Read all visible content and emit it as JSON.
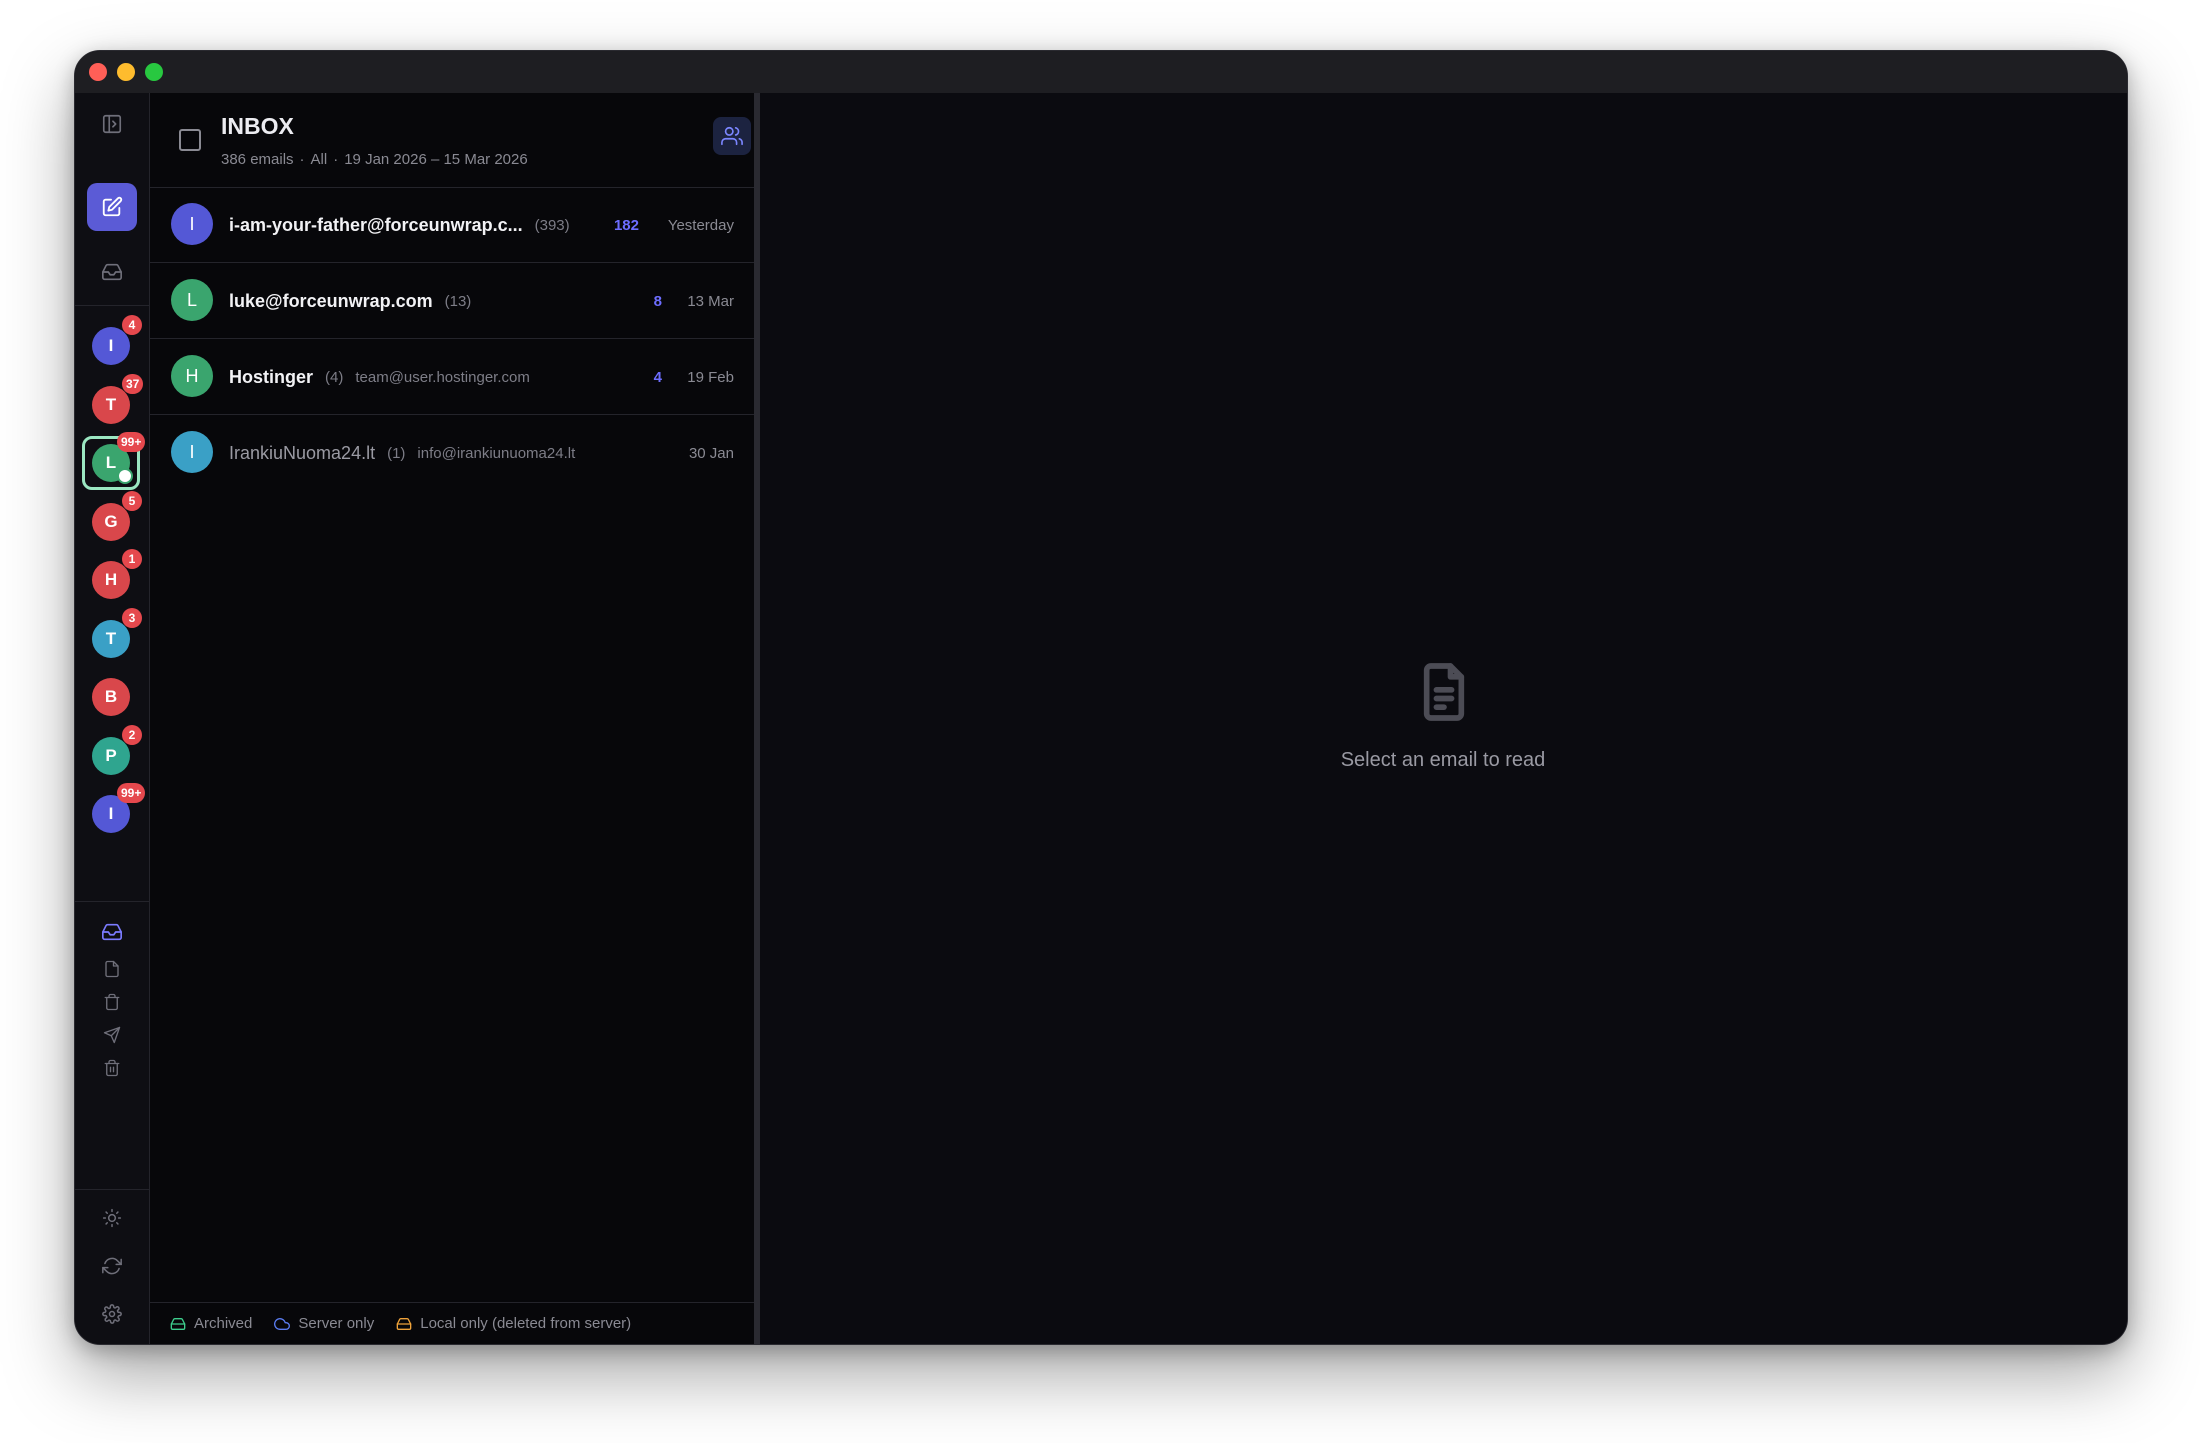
{
  "header": {
    "title": "INBOX",
    "email_count": "386 emails",
    "filter": "All",
    "date_range": "19 Jan 2026 – 15 Mar 2026"
  },
  "accounts": [
    {
      "initial": "I",
      "color": "#5458d6",
      "badge": "4"
    },
    {
      "initial": "T",
      "color": "#d9474b",
      "badge": "37"
    },
    {
      "initial": "L",
      "color": "#3aa56e",
      "badge": "99+",
      "selected": true
    },
    {
      "initial": "G",
      "color": "#d9474b",
      "badge": "5"
    },
    {
      "initial": "H",
      "color": "#d9474b",
      "badge": "1"
    },
    {
      "initial": "T",
      "color": "#3aa0c6",
      "badge": "3"
    },
    {
      "initial": "B",
      "color": "#d9474b",
      "badge": ""
    },
    {
      "initial": "P",
      "color": "#2fa58f",
      "badge": "2"
    },
    {
      "initial": "I",
      "color": "#5458d6",
      "badge": "99+"
    }
  ],
  "emails": [
    {
      "initial": "I",
      "color": "#5458d6",
      "sender": "i-am-your-father@forceunwrap.c...",
      "count": "(393)",
      "email": "",
      "unread": "182",
      "date": "Yesterday"
    },
    {
      "initial": "L",
      "color": "#3aa56e",
      "sender": "luke@forceunwrap.com",
      "count": "(13)",
      "email": "",
      "unread": "8",
      "date": "13 Mar"
    },
    {
      "initial": "H",
      "color": "#3aa56e",
      "sender": "Hostinger",
      "count": "(4)",
      "email": "team@user.hostinger.com",
      "unread": "4",
      "date": "19 Feb"
    },
    {
      "initial": "I",
      "color": "#3aa0c6",
      "sender": "IrankiuNuoma24.lt",
      "count": "(1)",
      "email": "info@irankiunuoma24.lt",
      "unread": "",
      "date": "30 Jan"
    }
  ],
  "legend": {
    "archived": "Archived",
    "server_only": "Server only",
    "local_only": "Local only (deleted from server)"
  },
  "legend_colors": {
    "archived": "#3ecf8e",
    "server_only": "#5a7cf0",
    "local_only": "#f0a33a"
  },
  "reader": {
    "empty_text": "Select an email to read"
  },
  "icons": {
    "sidebar_toggle": "sidebar-toggle-icon",
    "compose": "compose-icon",
    "inbox": "inbox-icon",
    "people": "people-icon",
    "search": "search-icon",
    "document": "document-icon"
  }
}
